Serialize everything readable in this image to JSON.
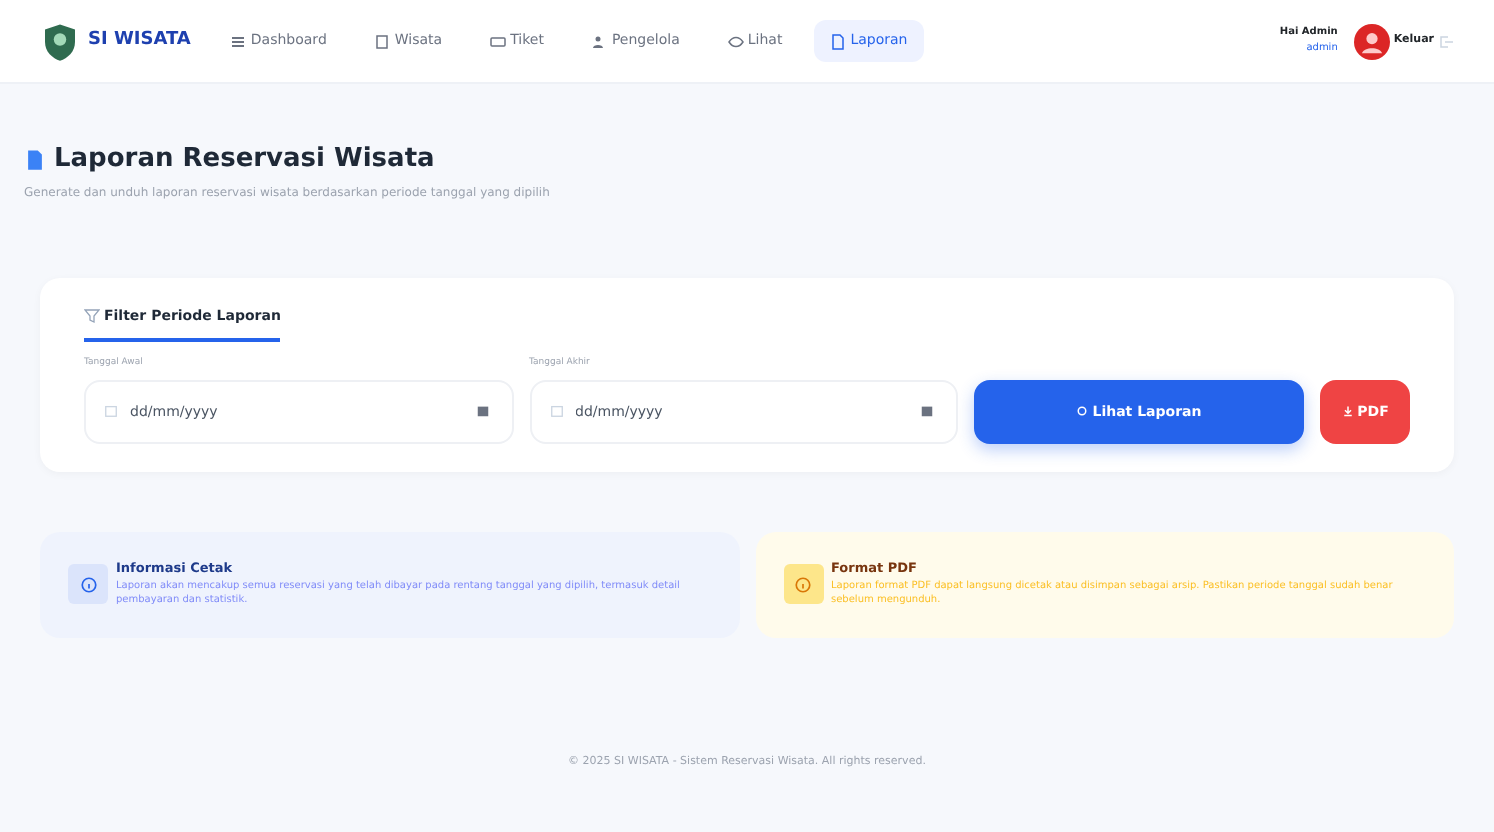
{
  "brand": "SI WISATA",
  "nav": [
    {
      "label": "Dashboard",
      "selected": false
    },
    {
      "label": "Wisata",
      "selected": false
    },
    {
      "label": "Tiket",
      "selected": false
    },
    {
      "label": "Pengelola",
      "selected": false
    },
    {
      "label": "Lihat",
      "selected": false
    },
    {
      "label": "Laporan",
      "selected": true
    }
  ],
  "user": {
    "greeting": "Hai Admin",
    "role": "admin",
    "name": "Keluar"
  },
  "page": {
    "title": "Laporan Reservasi Wisata",
    "subtitle": "Generate dan unduh laporan reservasi wisata berdasarkan periode tanggal yang dipilih"
  },
  "filter": {
    "title": "Filter Periode Laporan",
    "fields": [
      {
        "label": "Tanggal Awal",
        "placeholder": "dd/mm/yyyy"
      },
      {
        "label": "Tanggal Akhir",
        "placeholder": "dd/mm/yyyy"
      }
    ],
    "buttons": [
      {
        "label": "Lihat Laporan",
        "kind": "primary"
      },
      {
        "label": "PDF",
        "kind": "danger"
      }
    ]
  },
  "info": [
    {
      "title": "Informasi Cetak",
      "text": "Laporan akan mencakup semua reservasi yang telah dibayar pada rentang tanggal yang dipilih, termasuk detail pembayaran dan statistik.",
      "kind": "info"
    },
    {
      "title": "Format PDF",
      "text": "Laporan format PDF dapat langsung dicetak atau disimpan sebagai arsip. Pastikan periode tanggal sudah benar sebelum mengunduh.",
      "kind": "warning"
    }
  ],
  "footer": "© 2025 SI WISATA - Sistem Reservasi Wisata. All rights reserved."
}
